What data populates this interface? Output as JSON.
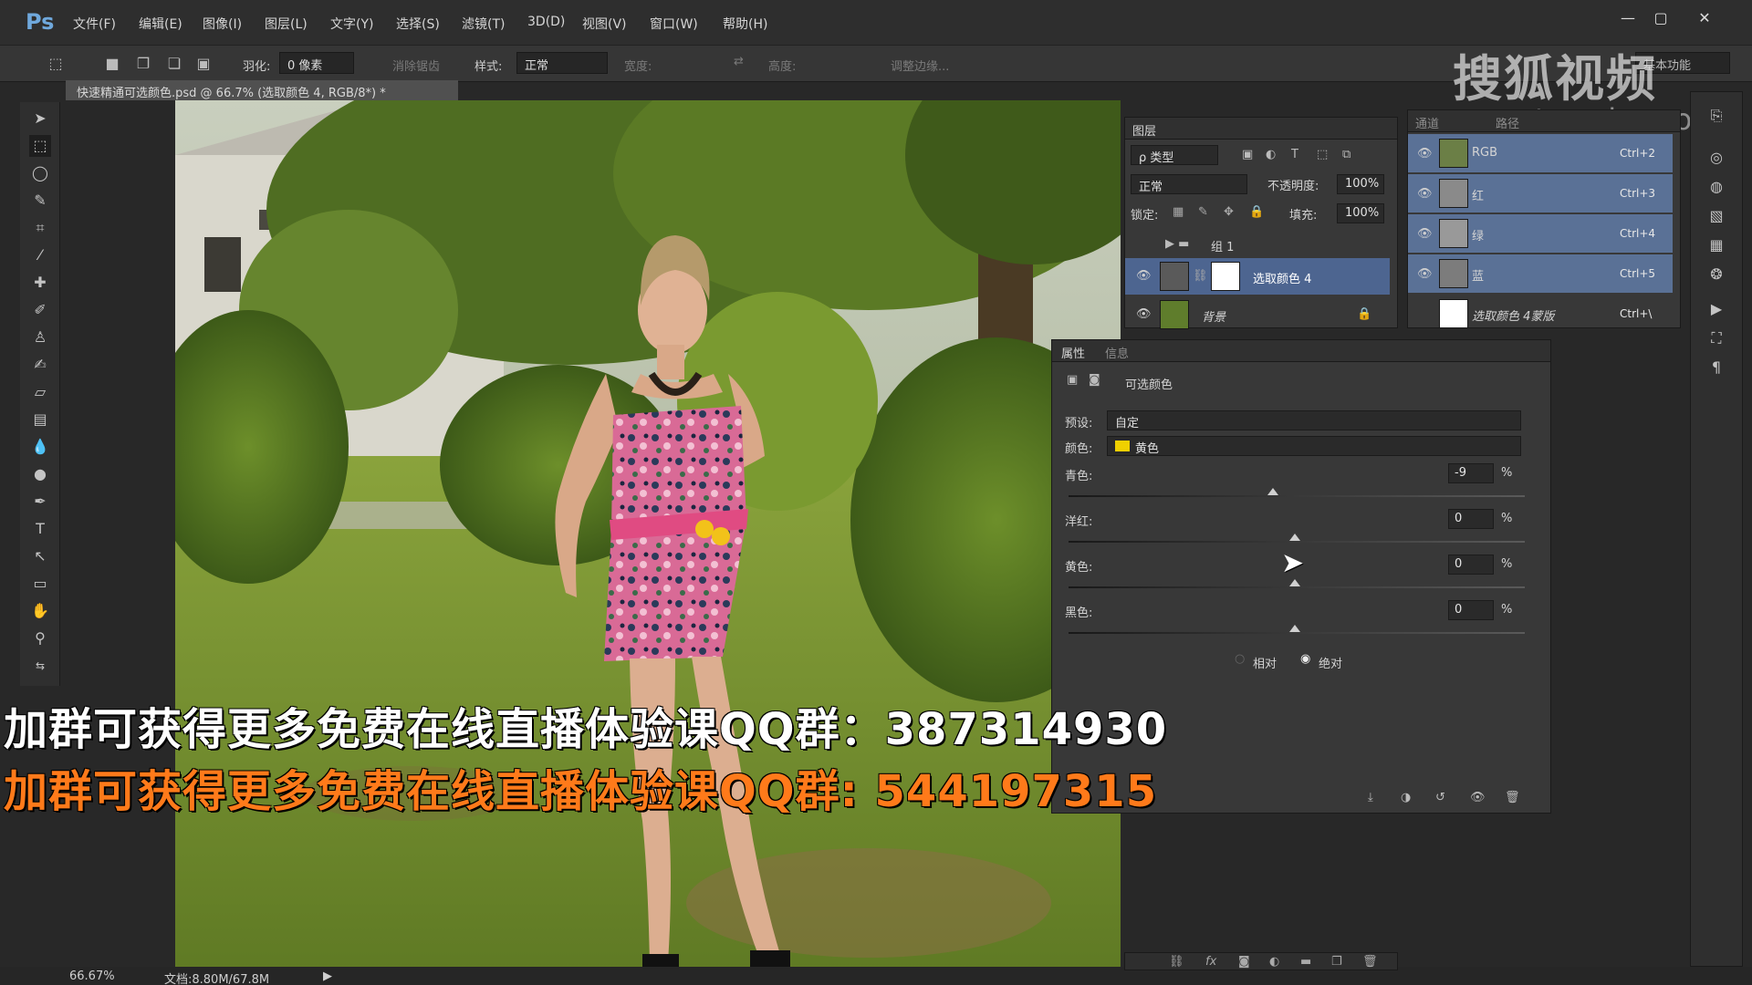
{
  "app": {
    "logo": "Ps",
    "menu": [
      "文件(F)",
      "编辑(E)",
      "图像(I)",
      "图层(L)",
      "文字(Y)",
      "选择(S)",
      "滤镜(T)",
      "3D(D)",
      "视图(V)",
      "窗口(W)",
      "帮助(H)"
    ],
    "window_controls": [
      "—",
      "▢",
      "✕"
    ]
  },
  "watermark": {
    "brand": "搜狐视频",
    "url": "tv.sohu.com"
  },
  "options": {
    "feather_label": "羽化:",
    "feather_value": "0 像素",
    "antialias_label": "消除锯齿",
    "style_label": "样式:",
    "style_value": "正常",
    "width_label": "宽度:",
    "height_label": "高度:",
    "refine_edge": "调整边缘...",
    "workspace": "基本功能"
  },
  "document": {
    "tab_title": "快速精通可选颜色.psd @ 66.7% (选取颜色 4, RGB/8*) *",
    "zoom": "66.67%",
    "doc_size": "文档:8.80M/67.8M"
  },
  "layers_panel": {
    "title": "图层",
    "filter_kind": "ρ 类型",
    "blend_mode": "正常",
    "opacity_label": "不透明度:",
    "opacity_value": "100%",
    "lock_label": "锁定:",
    "fill_label": "填充:",
    "fill_value": "100%",
    "layers": [
      {
        "name": "组 1",
        "type": "group"
      },
      {
        "name": "选取颜色 4",
        "type": "adjustment",
        "selected": true
      },
      {
        "name": "背景",
        "type": "background",
        "locked": true
      }
    ]
  },
  "channels_panel": {
    "tabs": [
      "通道",
      "路径"
    ],
    "channels": [
      {
        "name": "RGB",
        "shortcut": "Ctrl+2"
      },
      {
        "name": "红",
        "shortcut": "Ctrl+3"
      },
      {
        "name": "绿",
        "shortcut": "Ctrl+4"
      },
      {
        "name": "蓝",
        "shortcut": "Ctrl+5"
      },
      {
        "name": "选取颜色 4蒙版",
        "shortcut": "Ctrl+\\"
      }
    ]
  },
  "properties_panel": {
    "tabs": [
      "属性",
      "信息"
    ],
    "title": "可选颜色",
    "preset_label": "预设:",
    "preset_value": "自定",
    "colors_label": "颜色:",
    "colors_value": "黄色",
    "colors_swatch": "#f0d000",
    "sliders": [
      {
        "label": "青色:",
        "value": "-9",
        "unit": "%"
      },
      {
        "label": "洋红:",
        "value": "0",
        "unit": "%"
      },
      {
        "label": "黄色:",
        "value": "0",
        "unit": "%"
      },
      {
        "label": "黑色:",
        "value": "0",
        "unit": "%"
      }
    ],
    "method_relative": "相对",
    "method_absolute": "绝对",
    "method_selected": "绝对"
  },
  "banners": [
    {
      "text": "加群可获得更多免费在线直播体验课QQ群：387314930",
      "color": "#ffffff"
    },
    {
      "text": "加群可获得更多免费在线直播体验课QQ群:  544197315",
      "color": "#ff7a1a"
    }
  ],
  "colors": {
    "panel_bg": "#383838",
    "selected_layer": "#4d6590",
    "selected_channel": "#5a7196",
    "accent_blue": "#6fa8dc"
  }
}
